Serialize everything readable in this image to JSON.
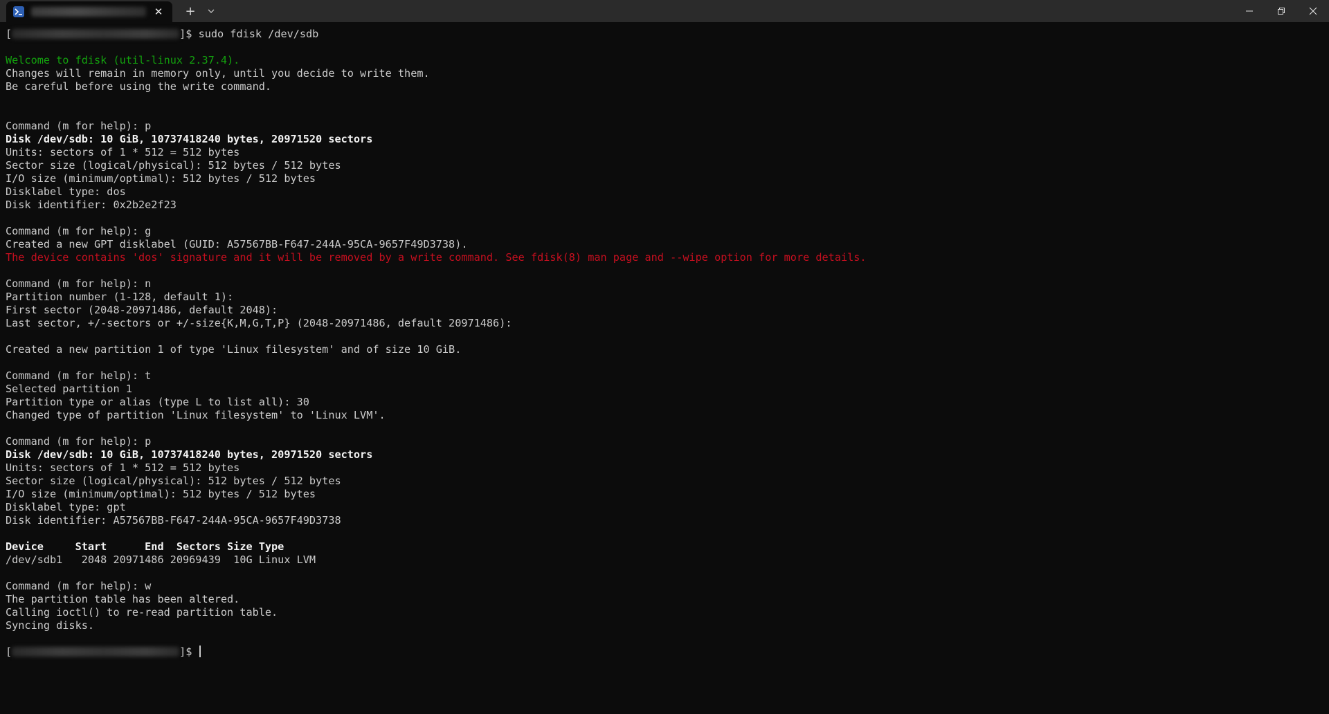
{
  "window": {
    "controls": {
      "minimize_icon": "minimize-icon",
      "maximize_icon": "restore-icon",
      "close_icon": "close-icon"
    },
    "colors": {
      "background": "#0c0c0c",
      "titlebar": "#2b2b2b",
      "text": "#cccccc",
      "green": "#13a10e",
      "red": "#c50f1f"
    }
  },
  "tab": {
    "icon": "powershell-icon",
    "close_label": "✕"
  },
  "toolbar": {
    "new_tab_label": "+",
    "dropdown_label": "⌄"
  },
  "terminal": {
    "prompt_open": "[",
    "prompt_close": "]$ ",
    "lines": [
      {
        "text": "sudo fdisk /dev/sdb",
        "style": "prompt"
      },
      {
        "text": "",
        "style": "normal"
      },
      {
        "text": "Welcome to fdisk (util-linux 2.37.4).",
        "style": "green"
      },
      {
        "text": "Changes will remain in memory only, until you decide to write them.",
        "style": "normal"
      },
      {
        "text": "Be careful before using the write command.",
        "style": "normal"
      },
      {
        "text": "",
        "style": "normal"
      },
      {
        "text": "",
        "style": "normal"
      },
      {
        "text": "Command (m for help): p",
        "style": "normal"
      },
      {
        "text": "Disk /dev/sdb: 10 GiB, 10737418240 bytes, 20971520 sectors",
        "style": "bold"
      },
      {
        "text": "Units: sectors of 1 * 512 = 512 bytes",
        "style": "normal"
      },
      {
        "text": "Sector size (logical/physical): 512 bytes / 512 bytes",
        "style": "normal"
      },
      {
        "text": "I/O size (minimum/optimal): 512 bytes / 512 bytes",
        "style": "normal"
      },
      {
        "text": "Disklabel type: dos",
        "style": "normal"
      },
      {
        "text": "Disk identifier: 0x2b2e2f23",
        "style": "normal"
      },
      {
        "text": "",
        "style": "normal"
      },
      {
        "text": "Command (m for help): g",
        "style": "normal"
      },
      {
        "text": "Created a new GPT disklabel (GUID: A57567BB-F647-244A-95CA-9657F49D3738).",
        "style": "normal"
      },
      {
        "text": "The device contains 'dos' signature and it will be removed by a write command. See fdisk(8) man page and --wipe option for more details.",
        "style": "red"
      },
      {
        "text": "",
        "style": "normal"
      },
      {
        "text": "Command (m for help): n",
        "style": "normal"
      },
      {
        "text": "Partition number (1-128, default 1):",
        "style": "normal"
      },
      {
        "text": "First sector (2048-20971486, default 2048):",
        "style": "normal"
      },
      {
        "text": "Last sector, +/-sectors or +/-size{K,M,G,T,P} (2048-20971486, default 20971486):",
        "style": "normal"
      },
      {
        "text": "",
        "style": "normal"
      },
      {
        "text": "Created a new partition 1 of type 'Linux filesystem' and of size 10 GiB.",
        "style": "normal"
      },
      {
        "text": "",
        "style": "normal"
      },
      {
        "text": "Command (m for help): t",
        "style": "normal"
      },
      {
        "text": "Selected partition 1",
        "style": "normal"
      },
      {
        "text": "Partition type or alias (type L to list all): 30",
        "style": "normal"
      },
      {
        "text": "Changed type of partition 'Linux filesystem' to 'Linux LVM'.",
        "style": "normal"
      },
      {
        "text": "",
        "style": "normal"
      },
      {
        "text": "Command (m for help): p",
        "style": "normal"
      },
      {
        "text": "Disk /dev/sdb: 10 GiB, 10737418240 bytes, 20971520 sectors",
        "style": "bold"
      },
      {
        "text": "Units: sectors of 1 * 512 = 512 bytes",
        "style": "normal"
      },
      {
        "text": "Sector size (logical/physical): 512 bytes / 512 bytes",
        "style": "normal"
      },
      {
        "text": "I/O size (minimum/optimal): 512 bytes / 512 bytes",
        "style": "normal"
      },
      {
        "text": "Disklabel type: gpt",
        "style": "normal"
      },
      {
        "text": "Disk identifier: A57567BB-F647-244A-95CA-9657F49D3738",
        "style": "normal"
      },
      {
        "text": "",
        "style": "normal"
      },
      {
        "text": "Device     Start      End  Sectors Size Type",
        "style": "bold"
      },
      {
        "text": "/dev/sdb1   2048 20971486 20969439  10G Linux LVM",
        "style": "normal"
      },
      {
        "text": "",
        "style": "normal"
      },
      {
        "text": "Command (m for help): w",
        "style": "normal"
      },
      {
        "text": "The partition table has been altered.",
        "style": "normal"
      },
      {
        "text": "Calling ioctl() to re-read partition table.",
        "style": "normal"
      },
      {
        "text": "Syncing disks.",
        "style": "normal"
      },
      {
        "text": "",
        "style": "normal"
      },
      {
        "text": "",
        "style": "prompt-cursor"
      }
    ]
  }
}
